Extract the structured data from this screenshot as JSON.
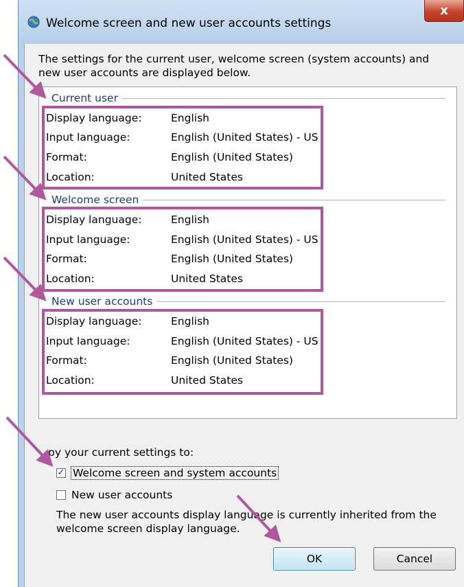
{
  "window": {
    "title": "Welcome screen and new user accounts settings",
    "close_label": "x"
  },
  "intro_text": "The settings for the current user, welcome screen (system accounts) and new user accounts are displayed below.",
  "groups": [
    {
      "title": "Current user",
      "rows": [
        {
          "key": "Display language:",
          "value": "English"
        },
        {
          "key": "Input language:",
          "value": "English (United States) - US"
        },
        {
          "key": "Format:",
          "value": "English (United States)"
        },
        {
          "key": "Location:",
          "value": "United States"
        }
      ]
    },
    {
      "title": "Welcome screen",
      "rows": [
        {
          "key": "Display language:",
          "value": "English"
        },
        {
          "key": "Input language:",
          "value": "English (United States) - US"
        },
        {
          "key": "Format:",
          "value": "English (United States)"
        },
        {
          "key": "Location:",
          "value": "United States"
        }
      ]
    },
    {
      "title": "New user accounts",
      "rows": [
        {
          "key": "Display language:",
          "value": "English"
        },
        {
          "key": "Input language:",
          "value": "English (United States) - US"
        },
        {
          "key": "Format:",
          "value": "English (United States)"
        },
        {
          "key": "Location:",
          "value": "United States"
        }
      ]
    }
  ],
  "copy_section": {
    "label": "py your current settings to:",
    "checkbox_welcome": {
      "label": "Welcome screen and system accounts",
      "checked": true
    },
    "checkbox_new_users": {
      "label": "New user accounts",
      "checked": false
    },
    "note": "The new user accounts display language is currently inherited from the welcome screen display language."
  },
  "buttons": {
    "ok": "OK",
    "cancel": "Cancel"
  },
  "colors": {
    "annotation": "#b0579d",
    "group_title": "#1a3a8f"
  }
}
